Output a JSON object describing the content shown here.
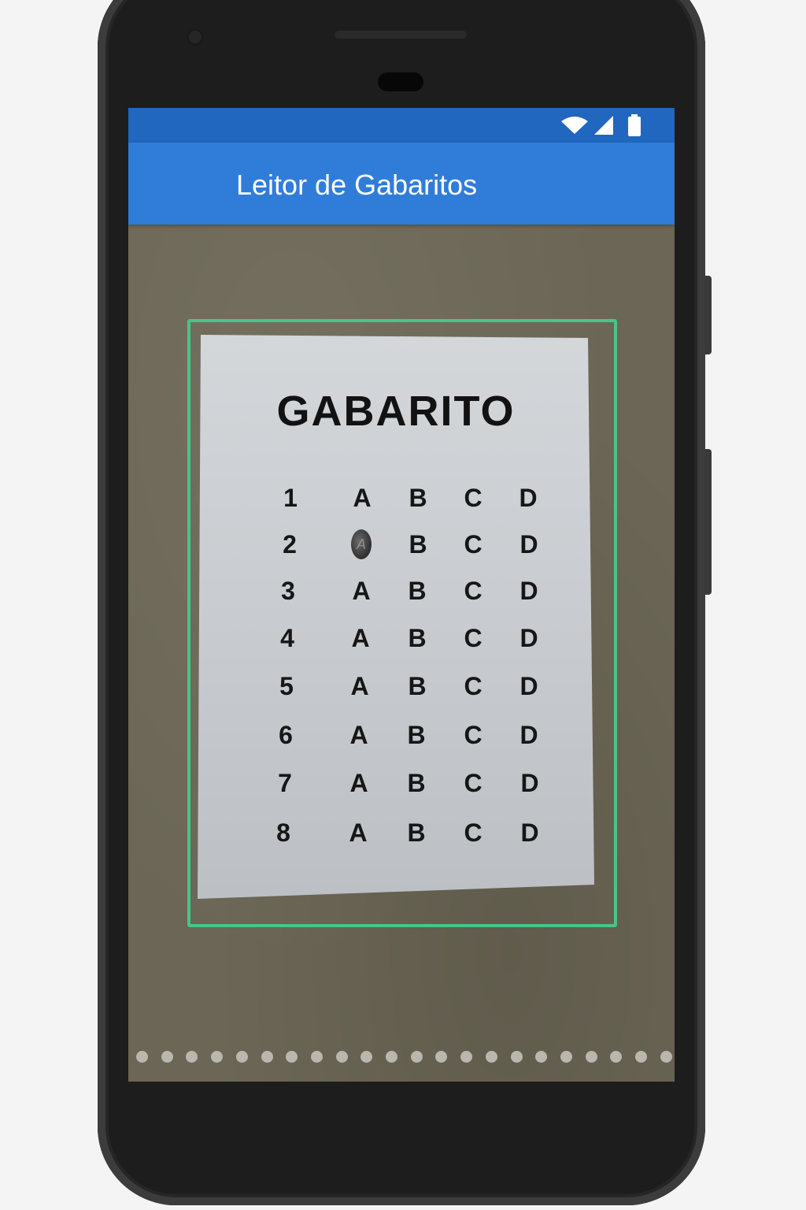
{
  "app": {
    "title": "Leitor de Gabaritos"
  },
  "status_bar": {
    "icons": [
      "wifi-icon",
      "cell-signal-icon",
      "battery-icon"
    ]
  },
  "sheet": {
    "title": "GABARITO",
    "options": [
      "A",
      "B",
      "C",
      "D"
    ],
    "questions": [
      {
        "number": "1",
        "marked": null
      },
      {
        "number": "2",
        "marked": "A"
      },
      {
        "number": "3",
        "marked": null
      },
      {
        "number": "4",
        "marked": null
      },
      {
        "number": "5",
        "marked": null
      },
      {
        "number": "6",
        "marked": null
      },
      {
        "number": "7",
        "marked": null
      },
      {
        "number": "8",
        "marked": null
      }
    ],
    "marked_text": "A"
  },
  "colors": {
    "status_bar": "#2166bf",
    "app_bar": "#307cd9",
    "detection_frame": "#48c48a",
    "background": "#6b6655"
  }
}
